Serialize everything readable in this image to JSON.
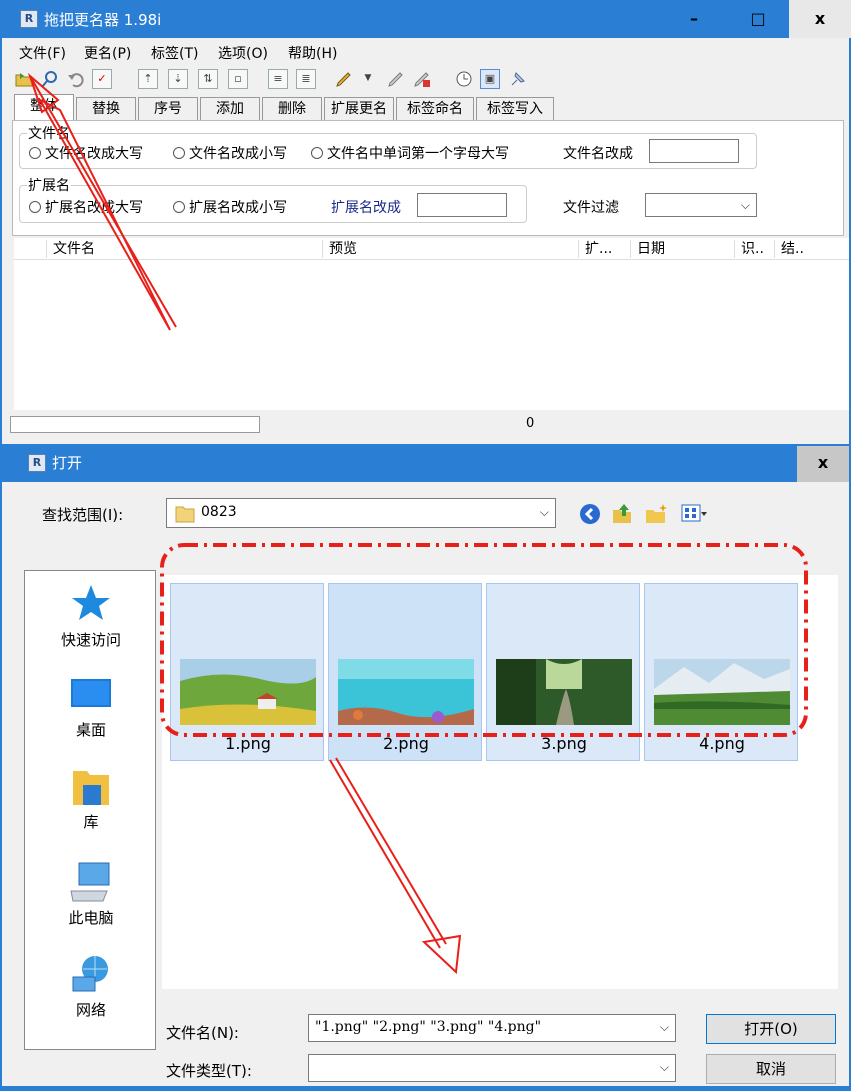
{
  "main": {
    "title": "拖把更名器 1.98i",
    "app_icon": "R",
    "window_controls": {
      "minimize": "–",
      "maximize": "□",
      "close": "x"
    },
    "menu": [
      "文件(F)",
      "更名(P)",
      "标签(T)",
      "选项(O)",
      "帮助(H)"
    ],
    "tabs": [
      "整体",
      "替换",
      "序号",
      "添加",
      "删除",
      "扩展更名",
      "标签命名",
      "标签写入"
    ],
    "filename_group": {
      "label": "文件名",
      "options": [
        "文件名改成大写",
        "文件名改成小写",
        "文件名中单词第一个字母大写"
      ],
      "rename_to_label": "文件名改成",
      "rename_to_value": ""
    },
    "ext_group": {
      "label": "扩展名",
      "options": [
        "扩展名改成大写",
        "扩展名改成小写"
      ],
      "rename_to_label": "扩展名改成",
      "rename_to_value": ""
    },
    "filter": {
      "label": "文件过滤",
      "value": ""
    },
    "columns": [
      "文件名",
      "预览",
      "扩...",
      "日期",
      "识..",
      "结.."
    ],
    "status_count": "0"
  },
  "dialog": {
    "title": "打开",
    "lookin_label": "查找范围(I):",
    "lookin_value": "0823",
    "places": [
      "快速访问",
      "桌面",
      "库",
      "此电脑",
      "网络"
    ],
    "files": [
      "1.png",
      "2.png",
      "3.png",
      "4.png"
    ],
    "filename_label": "文件名(N):",
    "filename_value": "\"1.png\" \"2.png\" \"3.png\" \"4.png\"",
    "filetype_label": "文件类型(T):",
    "filetype_value": "",
    "open_button": "打开(O)",
    "cancel_button": "取消",
    "close_button": "x"
  },
  "colors": {
    "titlebar": "#2a7fd5",
    "annotation": "#e8201a",
    "close_hover": "#e81123"
  }
}
